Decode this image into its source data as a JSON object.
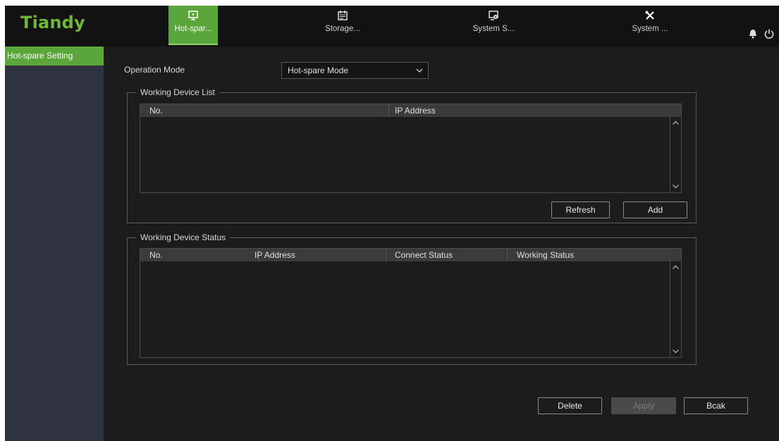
{
  "app": {
    "logo": "Tiandy",
    "accent_color": "#5aa63a"
  },
  "topnav": {
    "tabs": [
      {
        "label": "Hot-spar...",
        "icon": "monitor-icon",
        "active": true
      },
      {
        "label": "Storage...",
        "icon": "calendar-icon",
        "active": false
      },
      {
        "label": "System S...",
        "icon": "screen-settings-icon",
        "active": false
      },
      {
        "label": "System ...",
        "icon": "tools-icon",
        "active": false
      }
    ],
    "right_icons": [
      "bell-icon",
      "power-icon"
    ]
  },
  "sidebar": {
    "items": [
      {
        "label": "Hot-spare Setting",
        "active": true
      }
    ]
  },
  "form": {
    "operation_mode_label": "Operation Mode",
    "operation_mode_value": "Hot-spare Mode"
  },
  "working_device_list": {
    "legend": "Working Device List",
    "columns": [
      "No.",
      "IP Address"
    ],
    "rows": [],
    "refresh_label": "Refresh",
    "add_label": "Add"
  },
  "working_device_status": {
    "legend": "Working Device Status",
    "columns": [
      "No.",
      "IP Address",
      "Connect Status",
      "Working Status"
    ],
    "rows": []
  },
  "footer": {
    "delete_label": "Delete",
    "apply_label": "Apply",
    "back_label": "Bcak"
  }
}
